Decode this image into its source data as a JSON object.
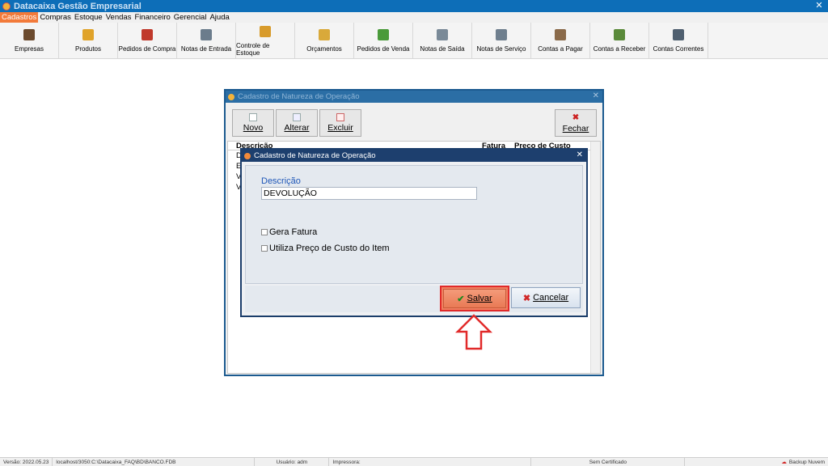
{
  "window": {
    "title": "Datacaixa Gestão Empresarial",
    "close_label": "✕"
  },
  "menu": [
    "Cadastros",
    "Compras",
    "Estoque",
    "Vendas",
    "Financeiro",
    "Gerencial",
    "Ajuda"
  ],
  "toolbar": [
    {
      "label": "Empresas",
      "icon": "users-icon",
      "color": "#6b4a2e"
    },
    {
      "label": "Produtos",
      "icon": "boxes-icon",
      "color": "#e0a32a"
    },
    {
      "label": "Pedidos de Compra",
      "icon": "clipboard-icon",
      "color": "#c0392b"
    },
    {
      "label": "Notas de Entrada",
      "icon": "document-icon",
      "color": "#6b7c8c"
    },
    {
      "label": "Controle de Estoque",
      "icon": "stock-icon",
      "color": "#d89b2b"
    },
    {
      "label": "Orçamentos",
      "icon": "notepad-icon",
      "color": "#d9a93a"
    },
    {
      "label": "Pedidos de Venda",
      "icon": "order-icon",
      "color": "#4a9a3a"
    },
    {
      "label": "Notas de Saída",
      "icon": "receipt-icon",
      "color": "#7a8a98"
    },
    {
      "label": "Notas de Serviço",
      "icon": "service-icon",
      "color": "#6f7f8e"
    },
    {
      "label": "Contas a Pagar",
      "icon": "pay-icon",
      "color": "#8a6a4a"
    },
    {
      "label": "Contas a Receber",
      "icon": "receive-icon",
      "color": "#5a8a3a"
    },
    {
      "label": "Contas Correntes",
      "icon": "safe-icon",
      "color": "#4f5f6f"
    }
  ],
  "back_dialog": {
    "title": "Cadastro de Natureza de Operação",
    "buttons": {
      "novo": "Novo",
      "alterar": "Alterar",
      "excluir": "Excluir",
      "fechar": "Fechar"
    },
    "columns": [
      "Descrição",
      "Fatura",
      "Preço de Custo"
    ],
    "rows": [
      "D",
      "E",
      "V",
      "V"
    ]
  },
  "front_dialog": {
    "title": "Cadastro de Natureza de Operação",
    "descricao_label": "Descrição",
    "descricao_value": "DEVOLUÇÃO",
    "gera_fatura_label": "Gera Fatura",
    "preco_custo_label": "Utiliza Preço de Custo do Item",
    "save_label": "Salvar",
    "cancel_label": "Cancelar"
  },
  "statusbar": {
    "version": "Versão: 2022.05.23",
    "db": "localhost/3050:C:\\Datacaixa_FAQ\\BD\\BANCO.FDB",
    "user": "Usuário: adm",
    "printer": "Impressora:",
    "cert": "Sem Certificado",
    "backup": "Backup Nuvem"
  },
  "colors": {
    "accent": "#f27a3a",
    "title_blue": "#0d6eb8",
    "highlight": "#e12a2a"
  }
}
